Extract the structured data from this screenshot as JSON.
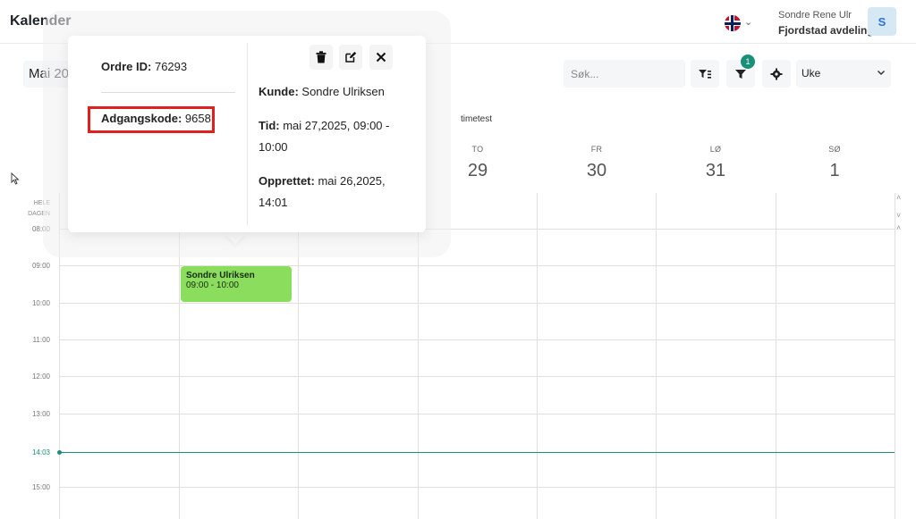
{
  "header": {
    "title": "Kalender",
    "user_name": "Sondre Rene Ulr",
    "branch": "Fjordstad avdeling",
    "avatar_initial": "S",
    "language_icon": "norway-flag-icon"
  },
  "toolbar": {
    "month": "Mai 20",
    "search_placeholder": "Søk...",
    "filter_badge": "1",
    "view": "Uke"
  },
  "calendar": {
    "resource": "timetest",
    "allday_label_1": "HELE",
    "allday_label_2": "DAGEN",
    "days": [
      {
        "name": "TO",
        "date": "29"
      },
      {
        "name": "FR",
        "date": "30"
      },
      {
        "name": "LØ",
        "date": "31"
      },
      {
        "name": "SØ",
        "date": "1"
      }
    ],
    "times": [
      "08:00",
      "09:00",
      "10:00",
      "11:00",
      "12:00",
      "13:00",
      "15:00"
    ],
    "now": "14:03",
    "event": {
      "title": "Sondre Ulriksen",
      "time": "09:00 - 10:00"
    }
  },
  "popover": {
    "order_label": "Ordre ID:",
    "order_value": "76293",
    "code_label": "Adgangskode:",
    "code_value": "9658",
    "customer_label": "Kunde:",
    "customer_value": "Sondre Ulriksen",
    "time_label": "Tid:",
    "time_value_1": "mai 27,2025, 09:00 -",
    "time_value_2": "10:00",
    "created_label": "Opprettet:",
    "created_value_1": "mai 26,2025,",
    "created_value_2": "14:01"
  },
  "colors": {
    "accent": "#1a8f7a",
    "event": "#8bdd5e",
    "highlight": "#e0201c"
  }
}
